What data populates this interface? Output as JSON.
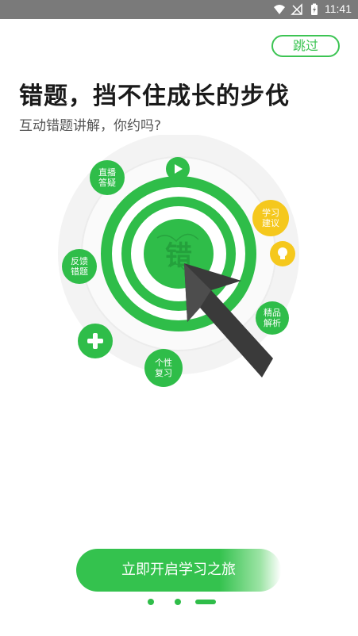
{
  "status_bar": {
    "time": "11:41"
  },
  "header": {
    "skip_label": "跳过"
  },
  "hero": {
    "title": "错题，挡不住成长的步伐",
    "subtitle": "互动错题讲解，你约吗?"
  },
  "diagram": {
    "center_char": "错",
    "nodes": {
      "live_answer": [
        "直播",
        "答疑"
      ],
      "study_advice": [
        "学习",
        "建议"
      ],
      "feedback": [
        "反馈",
        "错题"
      ],
      "premium_analysis": [
        "精品",
        "解析"
      ],
      "personal_review": [
        "个性",
        "复习"
      ]
    }
  },
  "cta": {
    "label": "立即开启学习之旅"
  },
  "pager": {
    "current_page": 3,
    "total_pages": 3
  },
  "colors": {
    "accent": "#2fbd49",
    "yellow": "#f5c81d",
    "statusbar": "#7a7a7a"
  }
}
